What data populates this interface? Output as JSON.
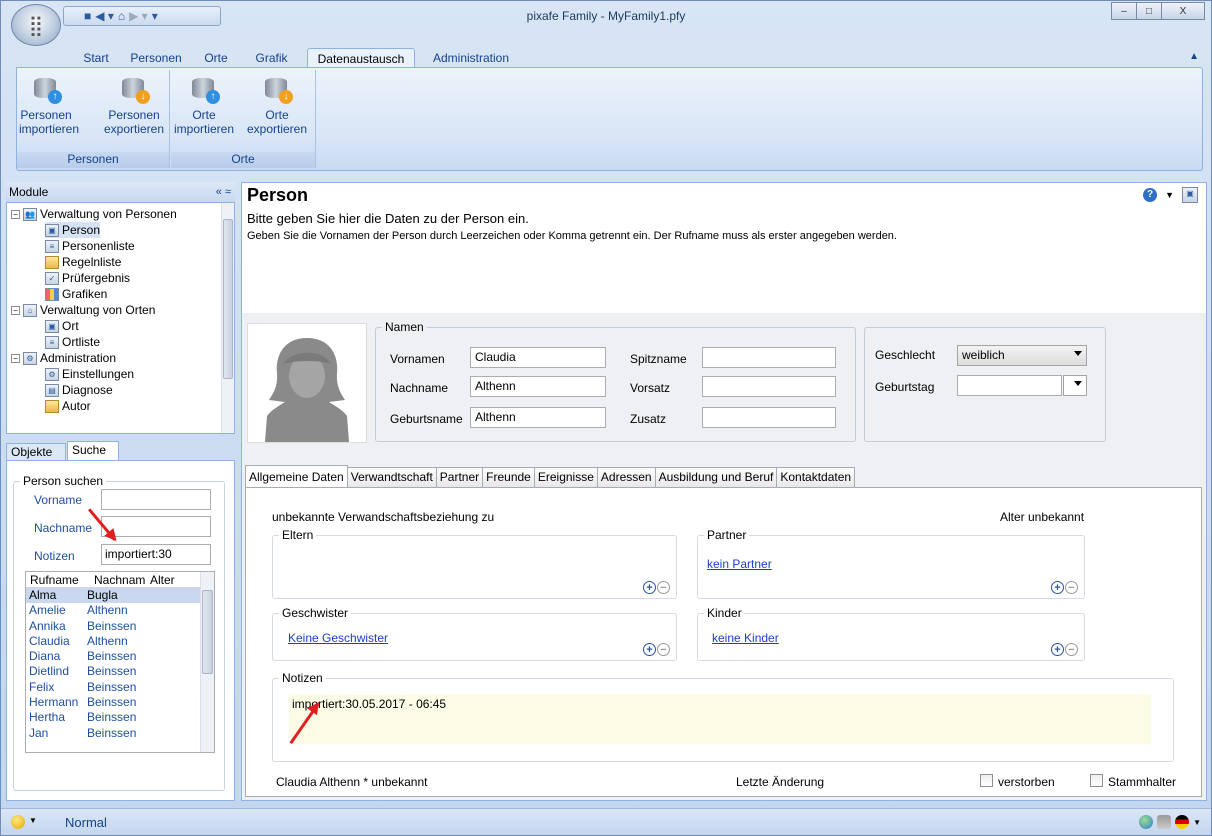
{
  "window": {
    "title": "pixafe Family - MyFamily1.pfy",
    "minimize": "–",
    "maximize": "□",
    "close": "X"
  },
  "qat": {
    "save_icon": "save-icon",
    "back_icon": "back-icon",
    "home_icon": "home-icon"
  },
  "ribbon": {
    "tabs": [
      "Start",
      "Personen",
      "Orte",
      "Grafik",
      "Datenaustausch",
      "Administration"
    ],
    "active_tab": "Datenaustausch",
    "groups": [
      {
        "label": "Personen",
        "buttons": [
          "Personen importieren",
          "Personen exportieren"
        ]
      },
      {
        "label": "Orte",
        "buttons": [
          "Orte importieren",
          "Orte exportieren"
        ]
      }
    ]
  },
  "modules": {
    "title": "Module",
    "tree": [
      {
        "label": "Verwaltung von Personen",
        "level": 0
      },
      {
        "label": "Person",
        "level": 1
      },
      {
        "label": "Personenliste",
        "level": 1
      },
      {
        "label": "Regelnliste",
        "level": 1
      },
      {
        "label": "Prüfergebnis",
        "level": 1
      },
      {
        "label": "Grafiken",
        "level": 1
      },
      {
        "label": "Verwaltung von Orten",
        "level": 0
      },
      {
        "label": "Ort",
        "level": 1
      },
      {
        "label": "Ortliste",
        "level": 1
      },
      {
        "label": "Administration",
        "level": 0
      },
      {
        "label": "Einstellungen",
        "level": 1
      },
      {
        "label": "Diagnose",
        "level": 1
      },
      {
        "label": "Autor",
        "level": 1
      }
    ]
  },
  "search": {
    "tabs": [
      "Objekte",
      "Suche"
    ],
    "active_tab": "Suche",
    "group": "Person suchen",
    "labels": {
      "vorname": "Vorname",
      "nachname": "Nachname",
      "notizen": "Notizen"
    },
    "values": {
      "vorname": "",
      "nachname": "",
      "notizen": "importiert:30"
    },
    "columns": [
      "Rufname",
      "Nachnam",
      "Alter"
    ],
    "rows": [
      [
        "Alma",
        "Bugla",
        ""
      ],
      [
        "Amelie",
        "Althenn",
        ""
      ],
      [
        "Annika",
        "Beinssen",
        ""
      ],
      [
        "Claudia",
        "Althenn",
        ""
      ],
      [
        "Diana",
        "Beinssen",
        ""
      ],
      [
        "Dietlind",
        "Beinssen",
        ""
      ],
      [
        "Felix",
        "Beinssen",
        ""
      ],
      [
        "Hermann",
        "Beinssen",
        ""
      ],
      [
        "Hertha",
        "Beinssen",
        ""
      ],
      [
        "Jan",
        "Beinssen",
        ""
      ]
    ]
  },
  "person": {
    "title": "Person",
    "subtitle": "Bitte geben Sie hier die Daten zu der Person ein.",
    "info": "Geben Sie die Vornamen der Person durch Leerzeichen oder Komma getrennt ein. Der Rufname muss als erster angegeben werden.",
    "namen": {
      "legend": "Namen",
      "vornamen_label": "Vornamen",
      "vornamen": "Claudia",
      "nachname_label": "Nachname",
      "nachname": "Althenn",
      "geburtsname_label": "Geburtsname",
      "geburtsname": "Althenn",
      "spitzname_label": "Spitzname",
      "spitzname": "",
      "vorsatz_label": "Vorsatz",
      "vorsatz": "",
      "zusatz_label": "Zusatz",
      "zusatz": ""
    },
    "geschlecht_label": "Geschlecht",
    "geschlecht": "weiblich",
    "geburtstag_label": "Geburtstag",
    "geburtstag": ""
  },
  "detail_tabs": [
    "Allgemeine Daten",
    "Verwandtschaft",
    "Partner",
    "Freunde",
    "Ereignisse",
    "Adressen",
    "Ausbildung und Beruf",
    "Kontaktdaten"
  ],
  "general": {
    "relation_text": "unbekannte Verwandschaftsbeziehung zu",
    "age_text": "Alter unbekannt",
    "eltern": "Eltern",
    "partner": "Partner",
    "partner_link": "kein Partner",
    "geschwister": "Geschwister",
    "geschwister_link": "Keine Geschwister",
    "kinder": "Kinder",
    "kinder_link": "keine Kinder",
    "notizen_label": "Notizen",
    "notizen": "importiert:30.05.2017 - 06:45",
    "footer_name": "Claudia Althenn  * unbekannt",
    "letzte_aenderung": "Letzte Änderung",
    "verstorben": "verstorben",
    "stammhalter": "Stammhalter",
    "plus": "+",
    "minus": "−"
  },
  "status": {
    "mode": "Normal"
  },
  "colors": {
    "accent": "#15428b",
    "link": "#1a3fc9",
    "arrow": "#e02020",
    "notes_bg": "#fcfce6"
  }
}
